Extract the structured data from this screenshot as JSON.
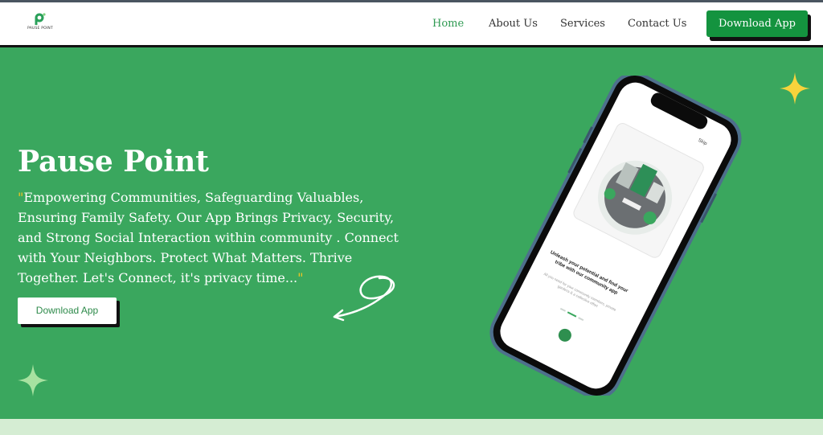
{
  "brand": {
    "name": "PAUSE POINT",
    "logo_letter": "P"
  },
  "nav": {
    "links": [
      {
        "label": "Home",
        "active": true
      },
      {
        "label": "About Us",
        "active": false
      },
      {
        "label": "Services",
        "active": false
      },
      {
        "label": "Contact Us",
        "active": false
      }
    ],
    "cta_label": "Download App"
  },
  "hero": {
    "title": "Pause Point",
    "quote_open": "\"",
    "description": "Empowering Communities, Safeguarding Valuables, Ensuring Family Safety. Our App Brings Privacy, Security, and Strong Social Interaction within community . Connect with Your Neighbors. Protect What Matters. Thrive Together. Let's Connect, it's privacy time...",
    "quote_close": "\"",
    "cta_label": "Download App"
  },
  "phone_screen": {
    "skip_label": "Skip",
    "heading": "Unleash your potential and find your tribe with our community app",
    "subtext": "All you need for your community members, private gardens & a collective effort"
  },
  "colors": {
    "hero_bg": "#3aa75e",
    "nav_active": "#2f9a52",
    "cta_green": "#14933f",
    "quote_yellow": "#f2c522",
    "sparkle_yellow": "#f7d33c",
    "sparkle_light_green": "#a7e2a0",
    "bottom_strip": "#d5edd3"
  },
  "icons": [
    "sparkle-icon",
    "swirl-arrow-icon",
    "logo-icon"
  ]
}
